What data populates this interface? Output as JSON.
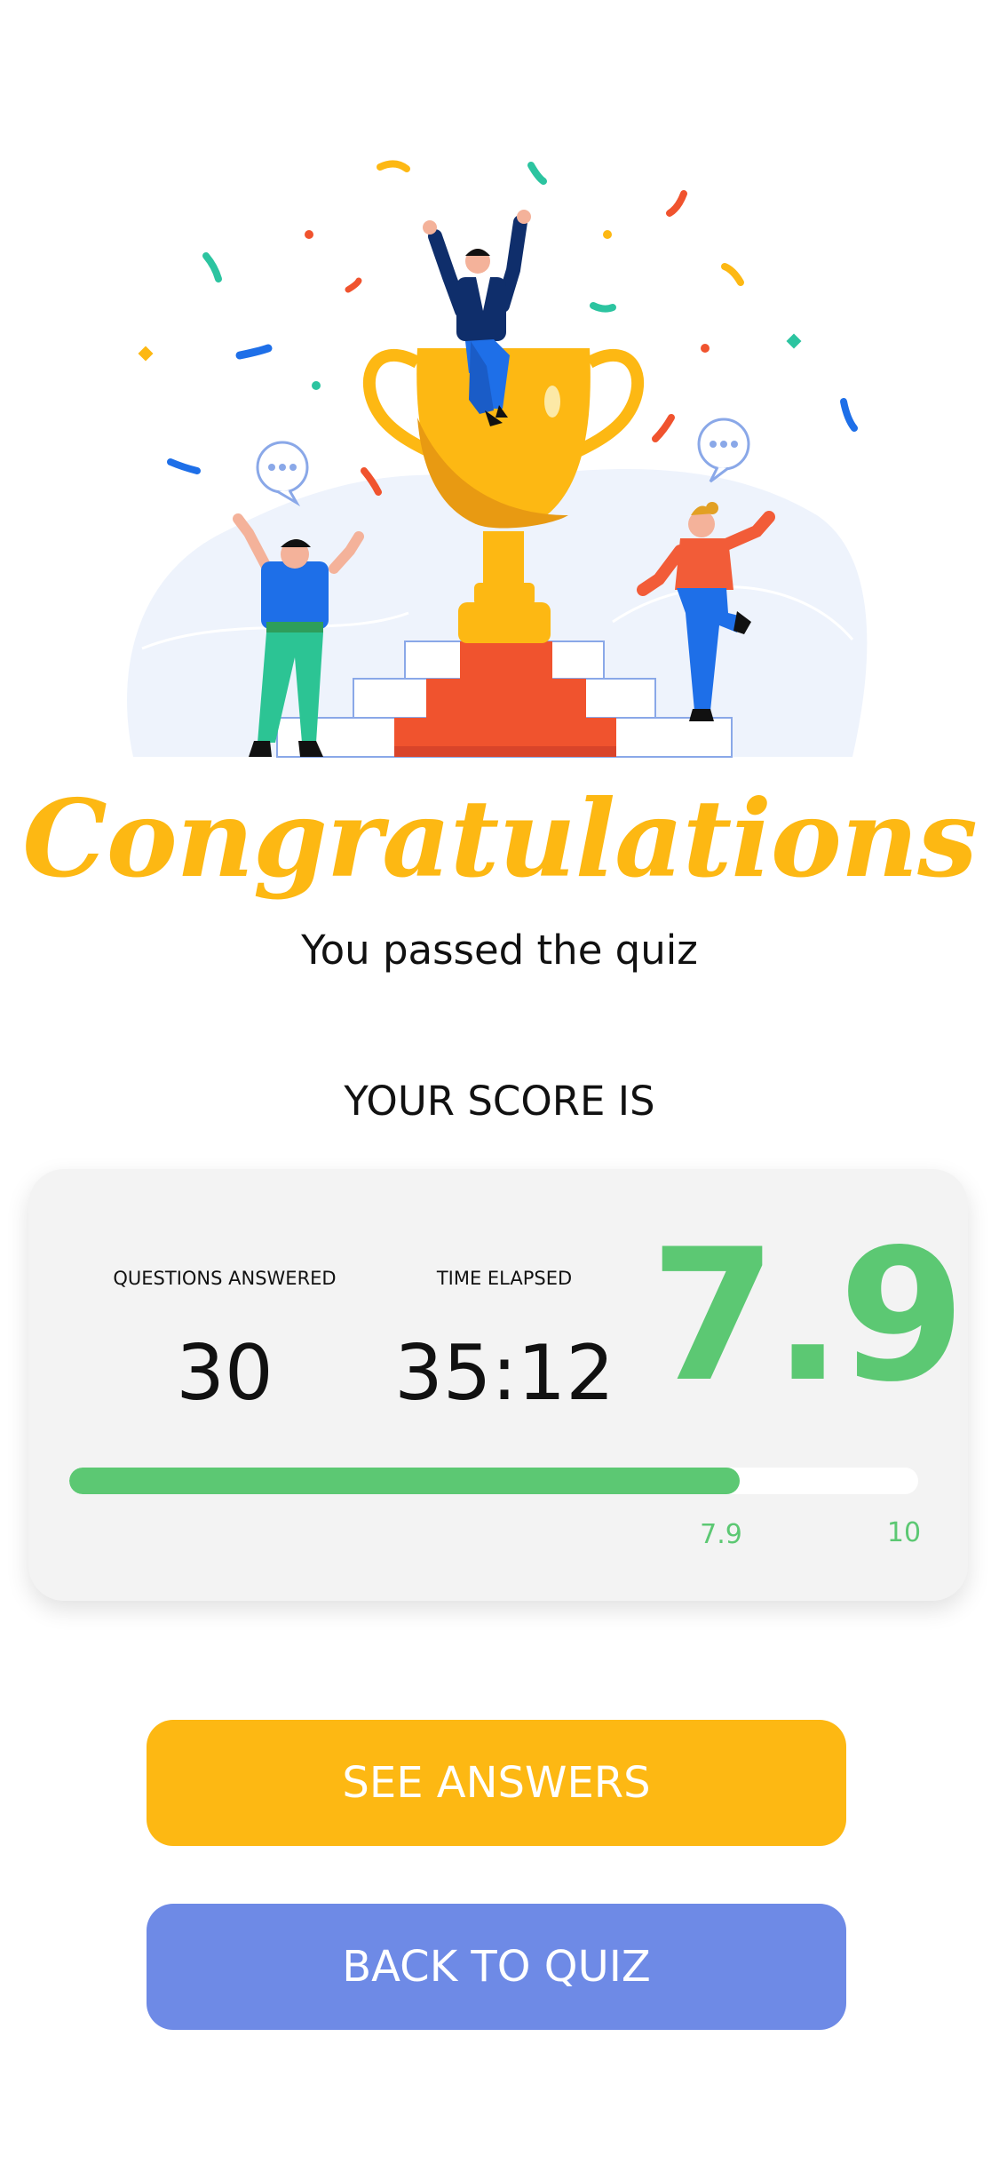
{
  "illustration": {
    "description_icon": "trophy-celebration-icon",
    "colors": {
      "trophy": "#FDB813",
      "podium": "#F0532E",
      "backdrop": "#EEF3FC",
      "speech": "#8AA8E8"
    }
  },
  "hero": {
    "title": "Congratulations",
    "subtitle": "You passed the quiz"
  },
  "score": {
    "heading": "YOUR SCORE IS",
    "questions_label": "QUESTIONS ANSWERED",
    "questions_value": "30",
    "time_label": "TIME ELAPSED",
    "time_value": "35:12",
    "score_value": "7.9",
    "max_value": "10",
    "progress_fraction": 0.79,
    "accent_color": "#5CC873"
  },
  "actions": {
    "see_answers_label": "SEE ANSWERS",
    "back_to_quiz_label": "BACK TO QUIZ",
    "see_answers_color": "#FDB813",
    "back_to_quiz_color": "#6E8AE6"
  }
}
